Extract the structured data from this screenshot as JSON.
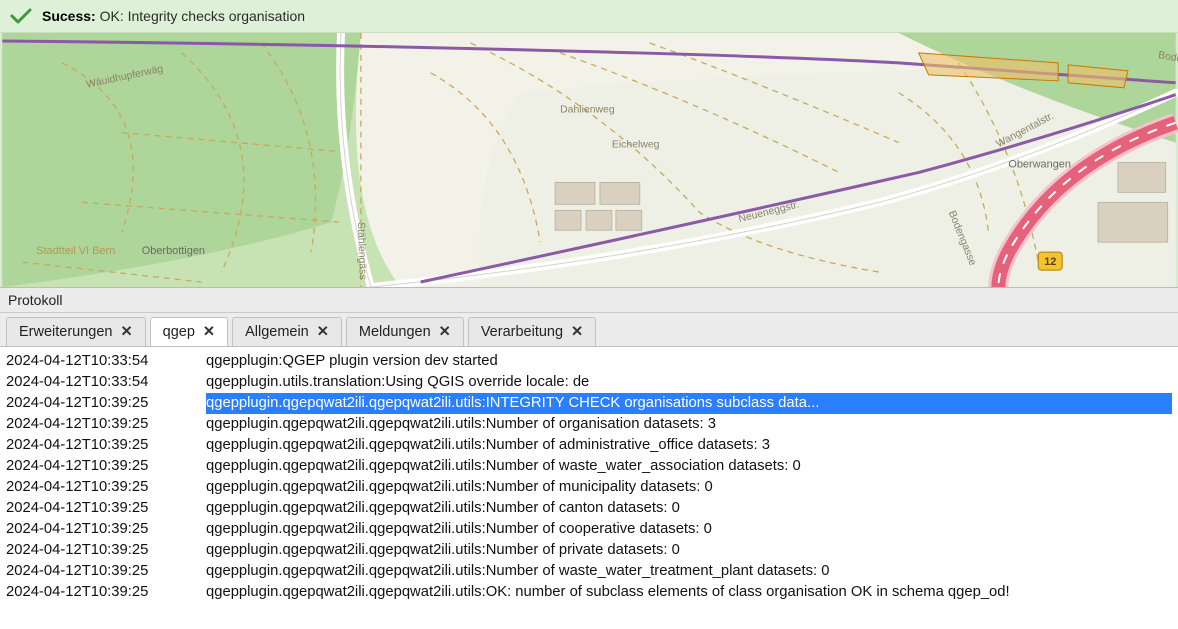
{
  "status_bar": {
    "label_bold": "Sucess:",
    "label_rest": " OK: Integrity checks organisation"
  },
  "panel_title": "Protokoll",
  "tabs": [
    {
      "label": "Erweiterungen",
      "active": false
    },
    {
      "label": "qgep",
      "active": true
    },
    {
      "label": "Allgemein",
      "active": false
    },
    {
      "label": "Meldungen",
      "active": false
    },
    {
      "label": "Verarbeitung",
      "active": false
    }
  ],
  "close_glyph": "✕",
  "log": [
    {
      "ts": "2024-04-12T10:33:54",
      "msg": "qgepplugin:QGEP plugin version dev started",
      "hl": false
    },
    {
      "ts": "2024-04-12T10:33:54",
      "msg": "qgepplugin.utils.translation:Using QGIS override locale: de",
      "hl": false
    },
    {
      "ts": "2024-04-12T10:39:25",
      "msg": "qgepplugin.qgepqwat2ili.qgepqwat2ili.utils:INTEGRITY CHECK organisations subclass data...",
      "hl": true
    },
    {
      "ts": "2024-04-12T10:39:25",
      "msg": "qgepplugin.qgepqwat2ili.qgepqwat2ili.utils:Number of organisation datasets: 3",
      "hl": false
    },
    {
      "ts": "2024-04-12T10:39:25",
      "msg": "qgepplugin.qgepqwat2ili.qgepqwat2ili.utils:Number of administrative_office datasets: 3",
      "hl": false
    },
    {
      "ts": "2024-04-12T10:39:25",
      "msg": "qgepplugin.qgepqwat2ili.qgepqwat2ili.utils:Number of waste_water_association datasets: 0",
      "hl": false
    },
    {
      "ts": "2024-04-12T10:39:25",
      "msg": "qgepplugin.qgepqwat2ili.qgepqwat2ili.utils:Number of municipality datasets: 0",
      "hl": false
    },
    {
      "ts": "2024-04-12T10:39:25",
      "msg": "qgepplugin.qgepqwat2ili.qgepqwat2ili.utils:Number of canton datasets: 0",
      "hl": false
    },
    {
      "ts": "2024-04-12T10:39:25",
      "msg": "qgepplugin.qgepqwat2ili.qgepqwat2ili.utils:Number of cooperative datasets: 0",
      "hl": false
    },
    {
      "ts": "2024-04-12T10:39:25",
      "msg": "qgepplugin.qgepqwat2ili.qgepqwat2ili.utils:Number of private datasets: 0",
      "hl": false
    },
    {
      "ts": "2024-04-12T10:39:25",
      "msg": "qgepplugin.qgepqwat2ili.qgepqwat2ili.utils:Number of waste_water_treatment_plant datasets: 0",
      "hl": false
    },
    {
      "ts": "2024-04-12T10:39:25",
      "msg": "qgepplugin.qgepqwat2ili.qgepqwat2ili.utils:OK: number of subclass elements of class organisation OK in schema qgep_od!",
      "hl": false
    }
  ],
  "map_labels": {
    "l1": "Wäuidhupferwäg",
    "l2": "Dahlienweg",
    "l3": "Eichelweg",
    "l4": "Stählengäss",
    "l5": "Stadtteil VI Bern",
    "l6": "Oberbottigen",
    "l7": "Neueneggstr.",
    "l8": "Wangentalstr.",
    "l9": "Oberwangen",
    "l10": "Bodengasse",
    "l11": "Bodengasse",
    "badge12": "12"
  }
}
